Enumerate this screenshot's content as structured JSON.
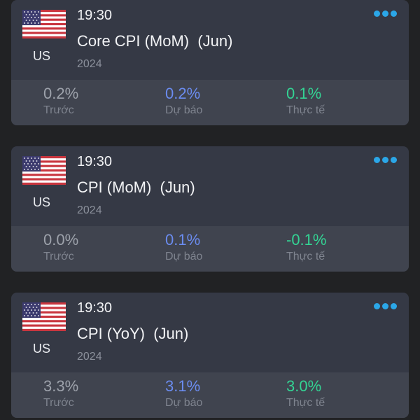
{
  "colors": {
    "background": "#212224",
    "card": "#353945",
    "card_footer": "#40444f",
    "previous": "#9da2ab",
    "forecast": "#6b8cf0",
    "actual": "#33d494",
    "menu_dots": "#2ba7e8"
  },
  "icons": {
    "flag": "us-flag-icon",
    "menu": "more-dots-icon"
  },
  "events": [
    {
      "country": "US",
      "time": "19:30",
      "title": "Core CPI (MoM)  (Jun)",
      "year": "2024",
      "previous": "0.2%",
      "forecast": "0.2%",
      "actual": "0.1%",
      "previous_label": "Trước",
      "forecast_label": "Dự báo",
      "actual_label": "Thực tế"
    },
    {
      "country": "US",
      "time": "19:30",
      "title": "CPI (MoM)  (Jun)",
      "year": "2024",
      "previous": "0.0%",
      "forecast": "0.1%",
      "actual": "-0.1%",
      "previous_label": "Trước",
      "forecast_label": "Dự báo",
      "actual_label": "Thực tế"
    },
    {
      "country": "US",
      "time": "19:30",
      "title": "CPI (YoY)  (Jun)",
      "year": "2024",
      "previous": "3.3%",
      "forecast": "3.1%",
      "actual": "3.0%",
      "previous_label": "Trước",
      "forecast_label": "Dự báo",
      "actual_label": "Thực tế"
    }
  ]
}
